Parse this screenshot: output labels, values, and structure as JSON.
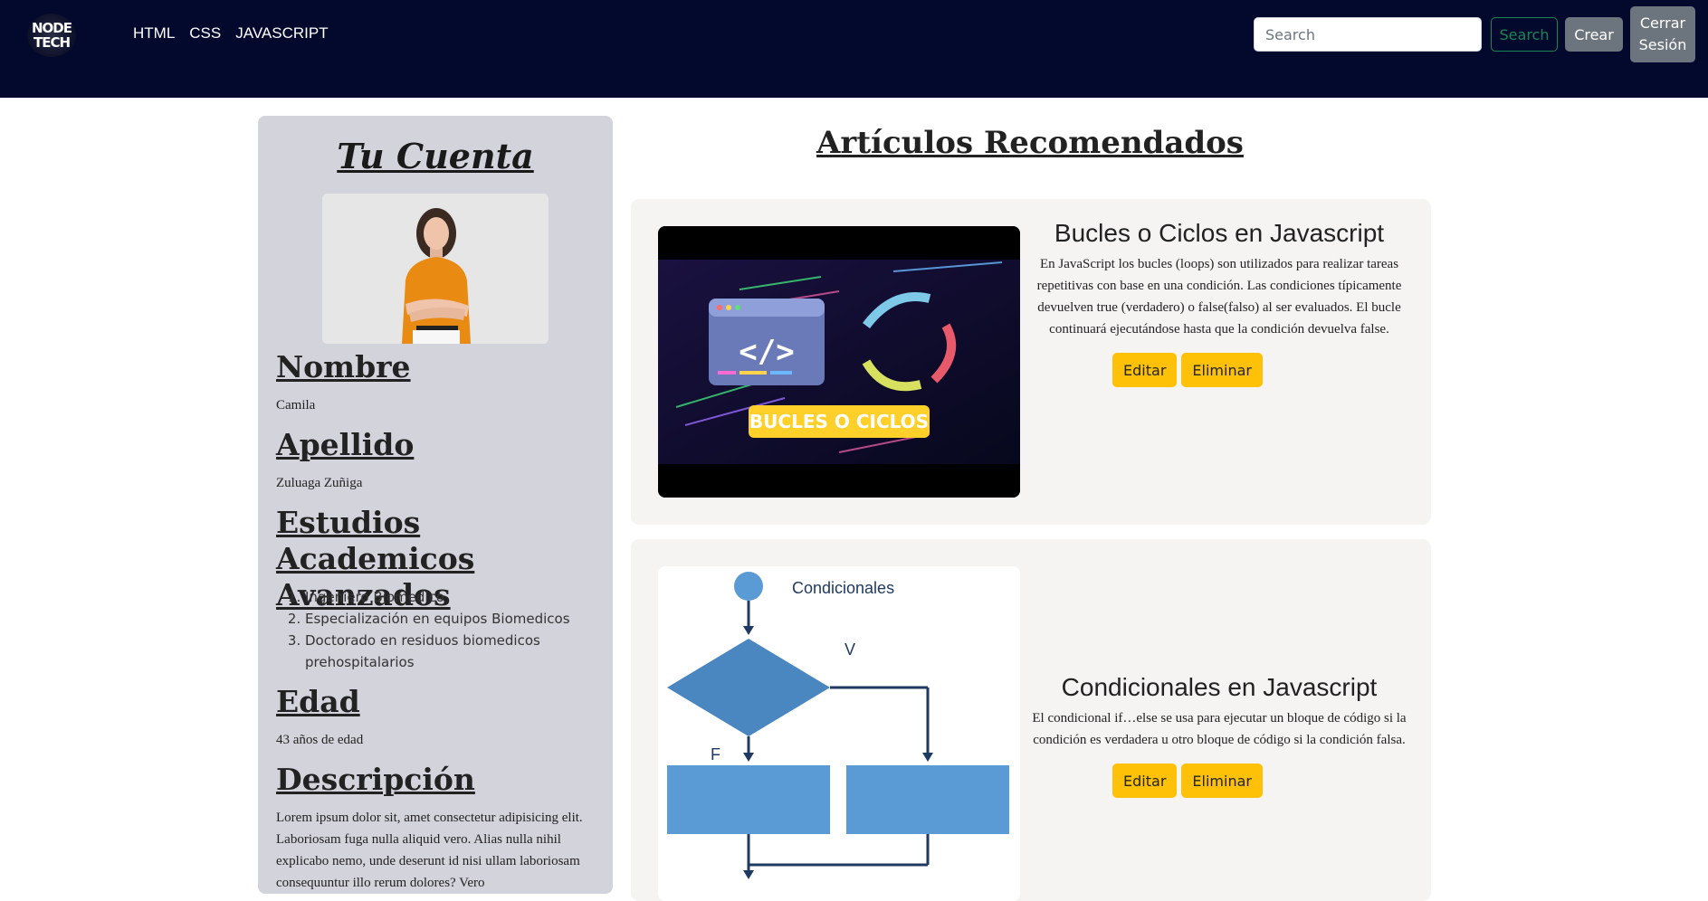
{
  "navbar": {
    "logo_line1": "NODE",
    "logo_line2": "TECH",
    "links": [
      "HTML",
      "CSS",
      "JAVASCRIPT"
    ],
    "search_placeholder": "Search",
    "search_button": "Search",
    "create_button": "Crear",
    "logout_button": "Cerrar Sesión"
  },
  "account": {
    "title": "Tu Cuenta",
    "name_label": "Nombre",
    "name_value": "Camila",
    "lastname_label": "Apellido",
    "lastname_value": "Zuluaga Zuñiga",
    "studies_label": "Estudios Academicos Avanzados",
    "studies": [
      "Ingeniero Biomedico",
      "Especialización en equipos Biomedicos",
      "Doctorado en residuos biomedicos prehospitalarios"
    ],
    "age_label": "Edad",
    "age_value": "43 años de edad",
    "description_label": "Descripción",
    "description_value": "Lorem ipsum dolor sit, amet consectetur adipisicing elit. Laboriosam fuga nulla aliquid vero. Alias nulla nihil explicabo nemo, unde deserunt id nisi ullam laboriosam consequuntur illo rerum dolores? Vero"
  },
  "articles": {
    "heading": "Artículos Recomendados",
    "edit_label": "Editar",
    "delete_label": "Eliminar",
    "items": [
      {
        "title": "Bucles o Ciclos en Javascript",
        "text": "En JavaScript los bucles (loops) son utilizados para realizar tareas repetitivas con base en una condición. Las condiciones típicamente devuelven true (verdadero) o false(falso) al ser evaluados. El bucle continuará ejecutándose hasta que la condición devuelva false.",
        "image_caption": "BUCLES O CICLOS"
      },
      {
        "title": "Condicionales en Javascript",
        "text": "El condicional if…else se usa para ejecutar un bloque de código si la condición es verdadera u otro bloque de código si la condición falsa.",
        "image_title": "Condicionales",
        "image_true_label": "V",
        "image_false_label": "F"
      }
    ]
  },
  "colors": {
    "navbar_bg": "#03082d",
    "sidebar_bg": "#d3d3dc",
    "card_bg": "#f5f4f3",
    "warning": "#ffc107",
    "success": "#198754",
    "secondary": "#6c757d"
  }
}
